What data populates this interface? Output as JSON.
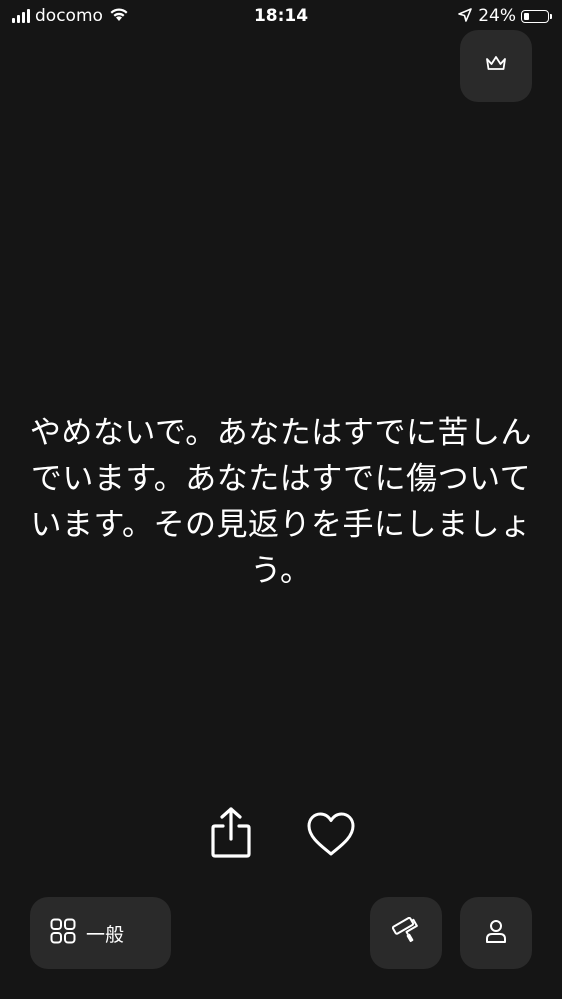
{
  "status_bar": {
    "carrier": "docomo",
    "time": "18:14",
    "battery_percent": "24%",
    "battery_level": 0.24
  },
  "quote": {
    "text": "やめないで。あなたはすでに苦しんでいます。あなたはすでに傷ついています。その見返りを手にしましょう。"
  },
  "bottom_bar": {
    "category_label": "一般"
  },
  "icons": {
    "premium": "crown-icon",
    "share": "share-icon",
    "like": "heart-icon",
    "category": "grid-icon",
    "theme": "paint-roller-icon",
    "profile": "person-icon"
  }
}
